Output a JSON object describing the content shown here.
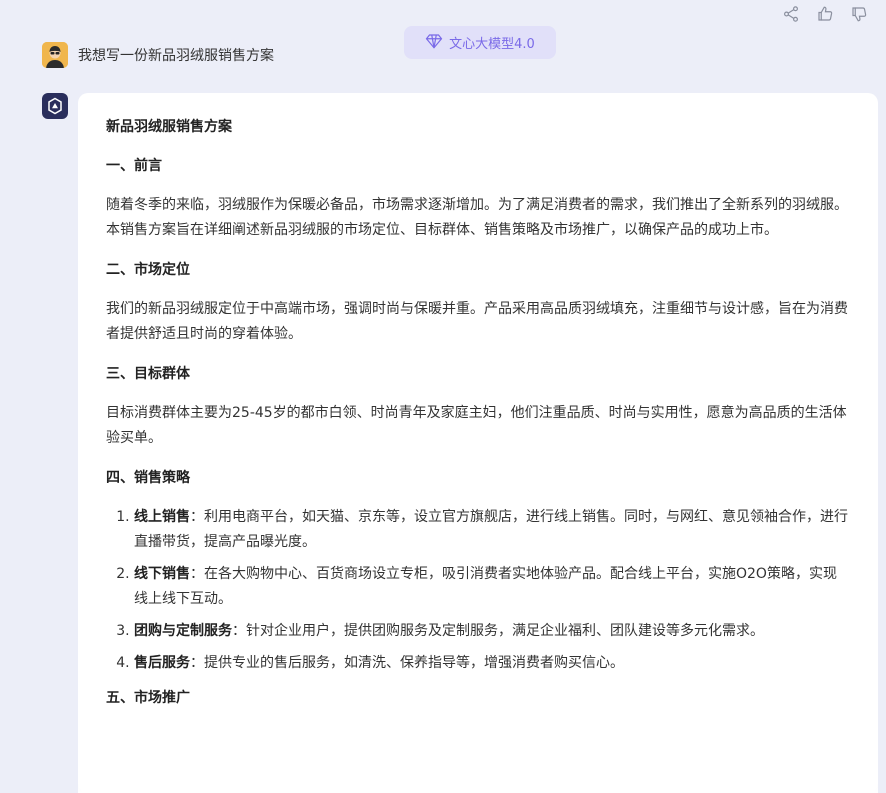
{
  "model_badge": {
    "label": "文心大模型4.0",
    "icon": "diamond-icon",
    "color": "#7a6ae8"
  },
  "actions": {
    "icons": [
      "share-icon",
      "thumbs-up-icon",
      "thumbs-down-icon"
    ]
  },
  "user_message": {
    "text": "我想写一份新品羽绒服销售方案"
  },
  "answer": {
    "title": "新品羽绒服销售方案",
    "sec1": {
      "heading": "一、前言",
      "body": "随着冬季的来临，羽绒服作为保暖必备品，市场需求逐渐增加。为了满足消费者的需求，我们推出了全新系列的羽绒服。本销售方案旨在详细阐述新品羽绒服的市场定位、目标群体、销售策略及市场推广，以确保产品的成功上市。"
    },
    "sec2": {
      "heading": "二、市场定位",
      "body": "我们的新品羽绒服定位于中高端市场，强调时尚与保暖并重。产品采用高品质羽绒填充，注重细节与设计感，旨在为消费者提供舒适且时尚的穿着体验。"
    },
    "sec3": {
      "heading": "三、目标群体",
      "body": "目标消费群体主要为25-45岁的都市白领、时尚青年及家庭主妇，他们注重品质、时尚与实用性，愿意为高品质的生活体验买单。"
    },
    "sec4": {
      "heading": "四、销售策略",
      "items": [
        {
          "label": "线上销售",
          "text": "：利用电商平台，如天猫、京东等，设立官方旗舰店，进行线上销售。同时，与网红、意见领袖合作，进行直播带货，提高产品曝光度。"
        },
        {
          "label": "线下销售",
          "text": "：在各大购物中心、百货商场设立专柜，吸引消费者实地体验产品。配合线上平台，实施O2O策略，实现线上线下互动。"
        },
        {
          "label": "团购与定制服务",
          "text": "：针对企业用户，提供团购服务及定制服务，满足企业福利、团队建设等多元化需求。"
        },
        {
          "label": "售后服务",
          "text": "：提供专业的售后服务，如清洗、保养指导等，增强消费者购买信心。"
        }
      ]
    },
    "sec5": {
      "heading": "五、市场推广"
    }
  }
}
